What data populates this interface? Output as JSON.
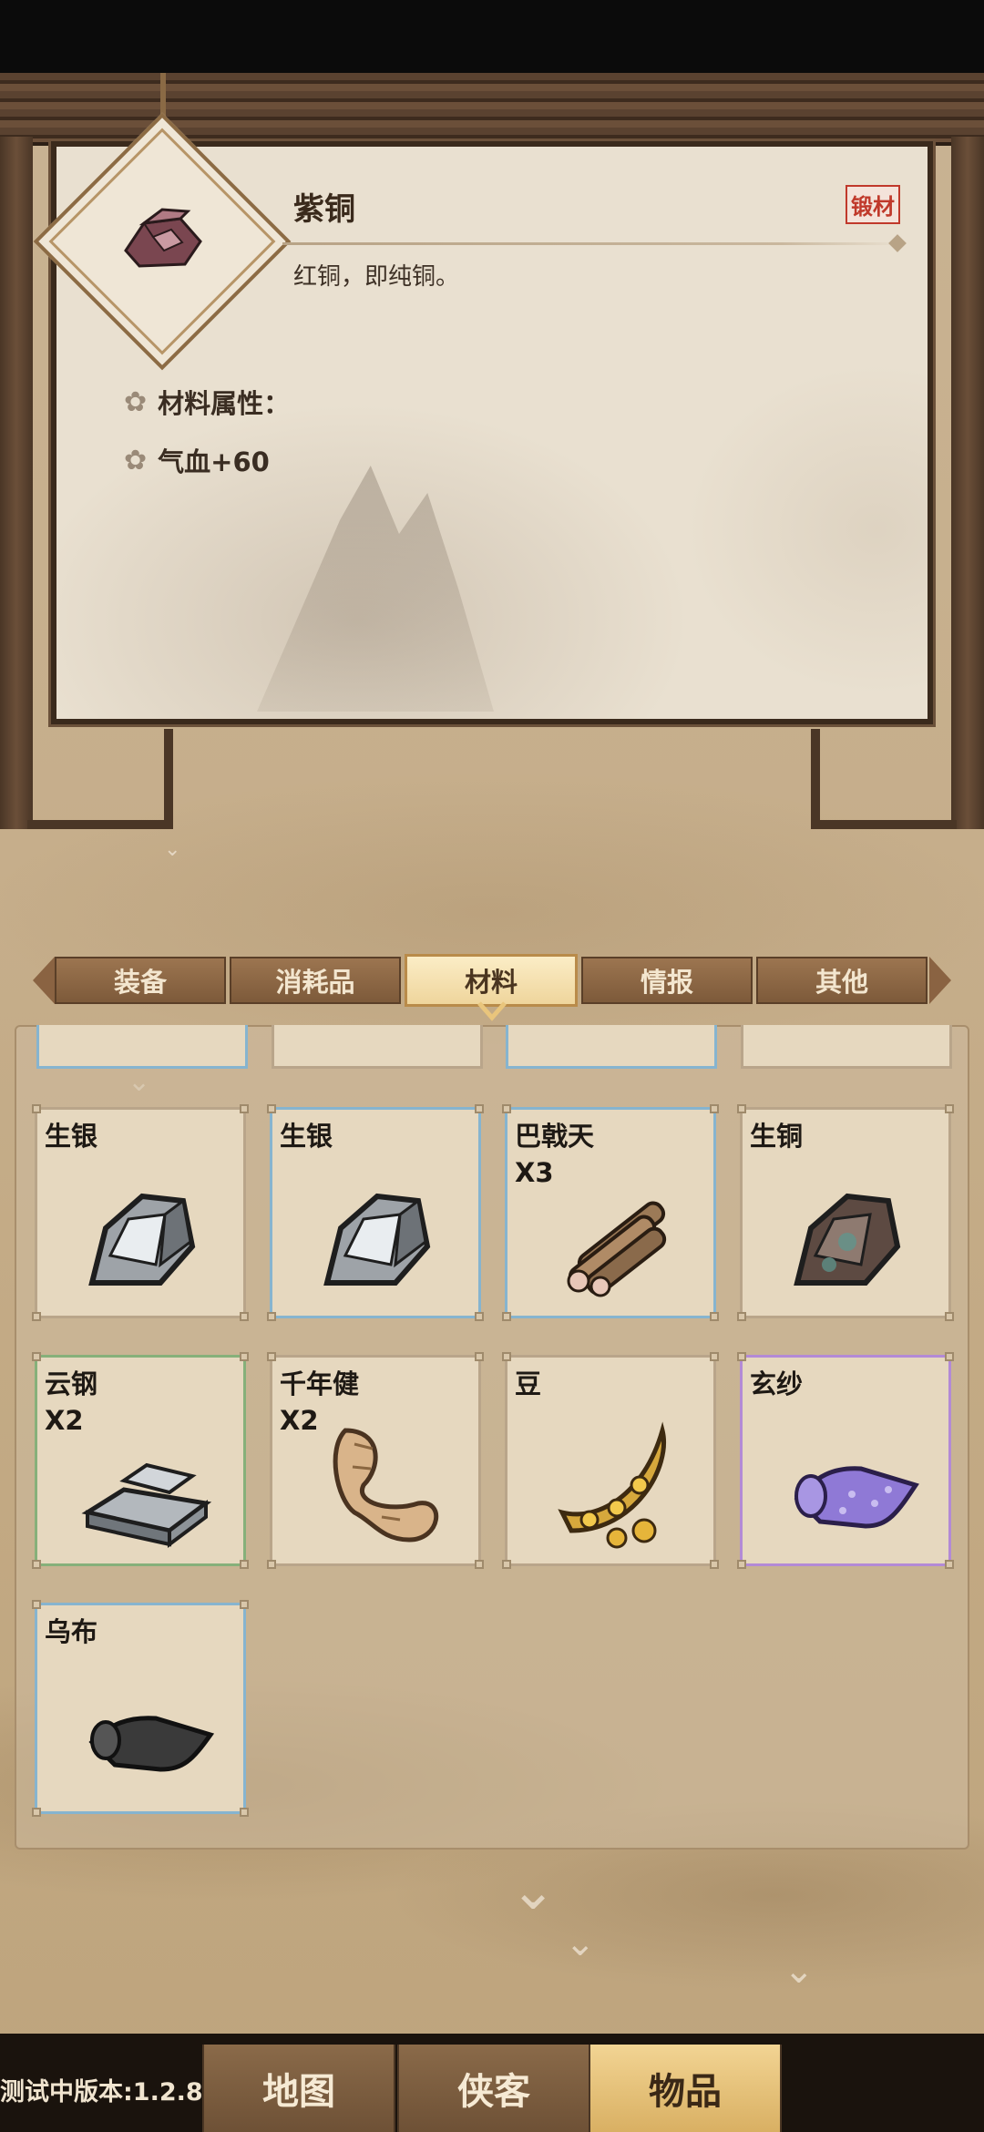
{
  "detail": {
    "name": "紫铜",
    "type_badge": "锻材",
    "description": "红铜，即纯铜。",
    "attr_title": "材料属性：",
    "attr_value": "气血+60"
  },
  "tabs": [
    {
      "label": "装备",
      "active": false
    },
    {
      "label": "消耗品",
      "active": false
    },
    {
      "label": "材料",
      "active": true
    },
    {
      "label": "情报",
      "active": false
    },
    {
      "label": "其他",
      "active": false
    }
  ],
  "items": [
    {
      "name": "生银",
      "count": "",
      "rarity": "common",
      "icon": "silver-ore-icon"
    },
    {
      "name": "生银",
      "count": "",
      "rarity": "blue",
      "icon": "silver-ore-icon"
    },
    {
      "name": "巴戟天",
      "count": "X3",
      "rarity": "blue",
      "icon": "wood-bundle-icon"
    },
    {
      "name": "生铜",
      "count": "",
      "rarity": "common",
      "icon": "copper-ore-icon"
    },
    {
      "name": "云钢",
      "count": "X2",
      "rarity": "green",
      "icon": "steel-ingot-icon"
    },
    {
      "name": "千年健",
      "count": "X2",
      "rarity": "common",
      "icon": "root-icon"
    },
    {
      "name": "豆",
      "count": "",
      "rarity": "common",
      "icon": "bean-pod-icon"
    },
    {
      "name": "玄纱",
      "count": "",
      "rarity": "purple",
      "icon": "purple-cloth-icon"
    },
    {
      "name": "乌布",
      "count": "",
      "rarity": "blue",
      "icon": "black-cloth-icon"
    }
  ],
  "bottom_nav": {
    "version": "测试中版本:1.2.8",
    "buttons": [
      {
        "label": "地图",
        "active": false
      },
      {
        "label": "侠客",
        "active": false
      },
      {
        "label": "物品",
        "active": true
      }
    ]
  },
  "colors": {
    "rarity_blue": "#86b4cf",
    "rarity_green": "#86b07a",
    "rarity_purple": "#b38ad6",
    "badge_red": "#c0392b"
  }
}
